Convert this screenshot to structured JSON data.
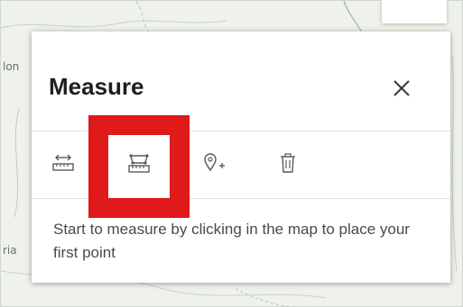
{
  "map": {
    "label_left_top": "lon",
    "label_left_bottom": "ria"
  },
  "panel": {
    "title": "Measure",
    "close_icon": "close-icon",
    "tools": [
      {
        "name": "distance",
        "icon": "measure-distance-icon"
      },
      {
        "name": "area",
        "icon": "measure-area-icon",
        "highlighted": true
      },
      {
        "name": "location",
        "icon": "measure-location-icon"
      },
      {
        "name": "clear",
        "icon": "trash-icon"
      }
    ],
    "hint": "Start to measure by clicking in the map to place your first point"
  },
  "colors": {
    "highlight": "#e0191b",
    "icon": "#5a5a5a",
    "title": "#1f1f1f",
    "text": "#4a4a4a"
  }
}
